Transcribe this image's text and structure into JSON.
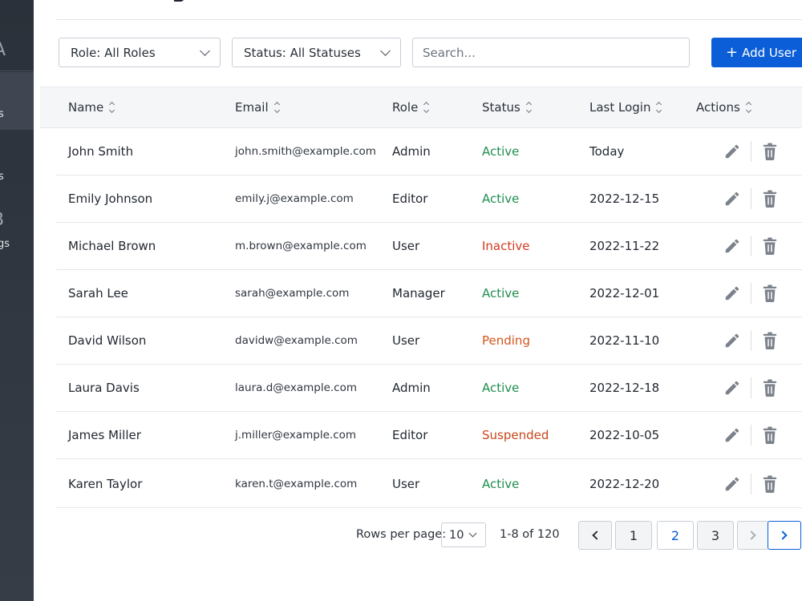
{
  "sidebar": {
    "fragments": [
      {
        "text": "A",
        "kind": "glyph"
      },
      {
        "text": "s",
        "kind": "label"
      },
      {
        "text": "s",
        "kind": "label"
      },
      {
        "text": "B",
        "kind": "glyph"
      },
      {
        "text": "gs",
        "kind": "label"
      }
    ]
  },
  "header": {
    "title_fragment": "g"
  },
  "filters": {
    "role_label": "Role:  All Roles",
    "status_label": "Status: All Statuses",
    "search_placeholder": "Search...",
    "add_user_label": "Add User",
    "add_user_icon": "plus-icon"
  },
  "table": {
    "columns": [
      {
        "key": "name",
        "label": "Name"
      },
      {
        "key": "email",
        "label": "Email"
      },
      {
        "key": "role",
        "label": "Role"
      },
      {
        "key": "status",
        "label": "Status"
      },
      {
        "key": "last_login",
        "label": "Last Login"
      },
      {
        "key": "actions",
        "label": "Actions"
      }
    ],
    "rows": [
      {
        "name": "John Smith",
        "email": "john.smith@example.com",
        "role": "Admin",
        "status": "Active",
        "last_login": "Today"
      },
      {
        "name": "Emily Johnson",
        "email": "emily.j@example.com",
        "role": "Editor",
        "status": "Active",
        "last_login": "2022-12-15"
      },
      {
        "name": "Michael Brown",
        "email": "m.brown@example.com",
        "role": "User",
        "status": "Inactive",
        "last_login": "2022-11-22"
      },
      {
        "name": "Sarah Lee",
        "email": "sarah@example.com",
        "role": "Manager",
        "status": "Active",
        "last_login": "2022-12-01"
      },
      {
        "name": "David Wilson",
        "email": "davidw@example.com",
        "role": "User",
        "status": "Pending",
        "last_login": "2022-11-10"
      },
      {
        "name": "Laura Davis",
        "email": "laura.d@example.com",
        "role": "Admin",
        "status": "Active",
        "last_login": "2022-12-18"
      },
      {
        "name": "James Miller",
        "email": "j.miller@example.com",
        "role": "Editor",
        "status": "Suspended",
        "last_login": "2022-10-05"
      },
      {
        "name": "Karen Taylor",
        "email": "karen.t@example.com",
        "role": "User",
        "status": "Active",
        "last_login": "2022-12-20"
      }
    ],
    "action_icons": [
      "pencil-icon",
      "trash-icon"
    ]
  },
  "pagination": {
    "rows_per_page_label": "Rows per page:",
    "rows_per_page_value": "10",
    "range_label": "1-8 of 120",
    "pages": [
      "1",
      "2",
      "3"
    ],
    "current_page": "2"
  },
  "colors": {
    "primary": "#0b5ed7",
    "active": "#1e8e4e",
    "inactive": "#d23a1e",
    "pending": "#d3561c",
    "suspended": "#c9461a",
    "sidebar_bg": "#2b313a",
    "icon_gray": "#7b828c"
  }
}
